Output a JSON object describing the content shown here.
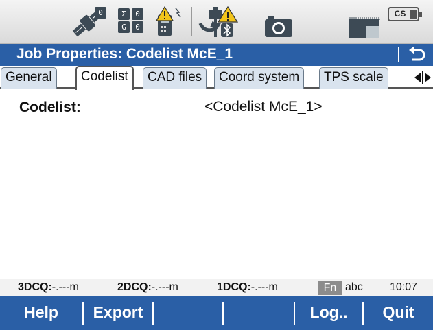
{
  "status_bar": {
    "icons": [
      "satellite-icon",
      "sigma-counter-icon",
      "radio-warning-icon",
      "instrument-bluetooth-icon",
      "camera-icon",
      "memory-card-icon",
      "cs-battery-icon"
    ],
    "counts": {
      "sigma": "Σ",
      "sigma_value": "0",
      "g_label": "G",
      "g_value": "0",
      "sat_value": "0"
    },
    "cs_label": "CS"
  },
  "title": {
    "text": "Job Properties: Codelist McE_1",
    "back_icon": "return-arrow-icon"
  },
  "tabs": [
    {
      "label": "General",
      "active": false
    },
    {
      "label": "Codelist",
      "active": true
    },
    {
      "label": "CAD files",
      "active": false
    },
    {
      "label": "Coord system",
      "active": false
    },
    {
      "label": "TPS scale",
      "active": false
    }
  ],
  "tab_scroll_icons": [
    "arrow-left-icon",
    "arrow-right-icon"
  ],
  "content": {
    "codelist_label": "Codelist:",
    "codelist_value": "<Codelist McE_1>"
  },
  "quality": {
    "q3_label": "3DCQ:",
    "q3_value": "-.---m",
    "q2_label": "2DCQ:",
    "q2_value": "-.---m",
    "q1_label": "1DCQ:",
    "q1_value": "-.---m",
    "fn": "Fn",
    "input_mode": "abc",
    "time": "10:07"
  },
  "softkeys": {
    "f1": "Help",
    "f2": "Export",
    "f3": "",
    "f4": "",
    "f5": "Log..",
    "f6": "Quit"
  },
  "colors": {
    "title_bar": "#2a5fa6",
    "softkey_bar": "#2a5fa6",
    "status_bg": "#e6e6e6",
    "warning": "#f2c41a"
  }
}
